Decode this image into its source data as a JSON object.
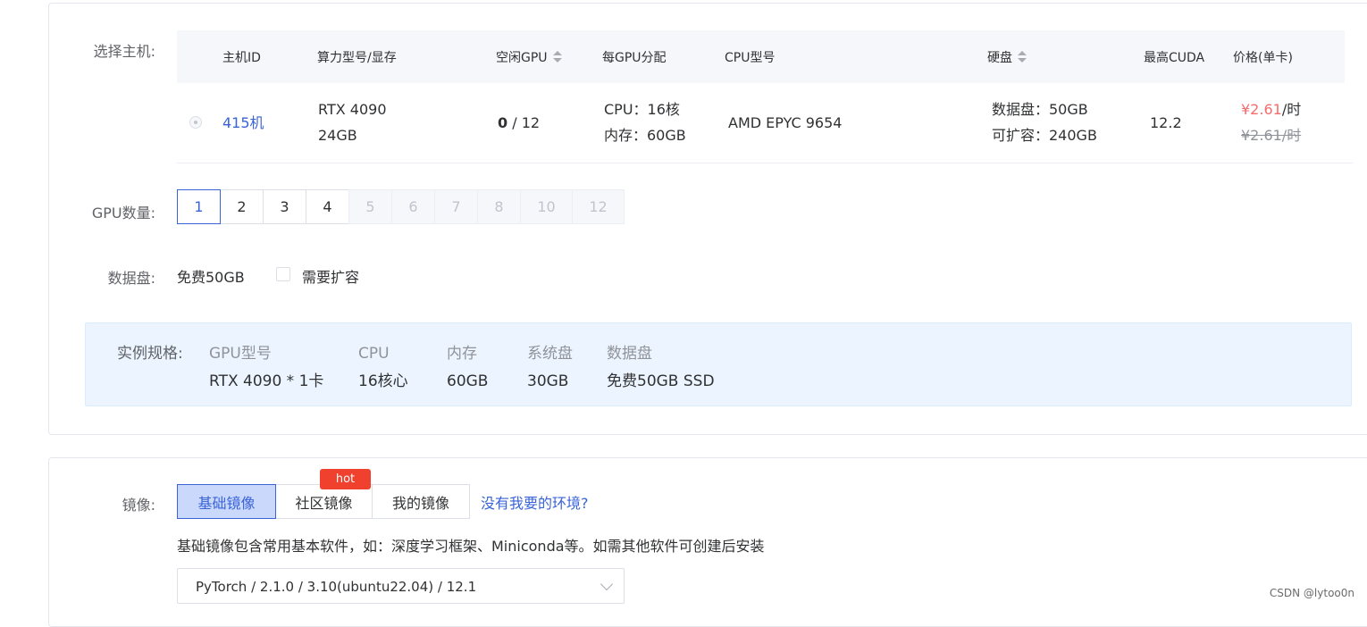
{
  "host_section": {
    "label": "选择主机:",
    "columns": {
      "host_id": "主机ID",
      "gpu_model": "算力型号/显存",
      "idle_gpu": "空闲GPU",
      "per_gpu": "每GPU分配",
      "cpu_model": "CPU型号",
      "disk": "硬盘",
      "max_cuda": "最高CUDA",
      "price": "价格(单卡)"
    },
    "row": {
      "host_name": "415机",
      "gpu_model": "RTX 4090",
      "vram": "24GB",
      "idle": "0",
      "idle_total": " / 12",
      "cpu": "CPU：16核",
      "mem": "内存：60GB",
      "cpu_model": "AMD EPYC 9654",
      "data_disk": "数据盘：50GB",
      "expandable": "可扩容：240GB",
      "cuda": "12.2",
      "price": "¥2.61",
      "price_unit": "/时",
      "original_price": "¥2.61/时"
    }
  },
  "gpu_count": {
    "label": "GPU数量:",
    "options": [
      "1",
      "2",
      "3",
      "4",
      "5",
      "6",
      "7",
      "8",
      "10",
      "12"
    ],
    "selected": "1"
  },
  "data_disk": {
    "label": "数据盘:",
    "free": "免费50GB",
    "expand_label": "需要扩容"
  },
  "spec": {
    "label": "实例规格:",
    "gpu_header": "GPU型号",
    "gpu_value": "RTX 4090 * 1卡",
    "cpu_header": "CPU",
    "cpu_value": "16核心",
    "mem_header": "内存",
    "mem_value": "60GB",
    "sys_header": "系统盘",
    "sys_value": "30GB",
    "data_header": "数据盘",
    "data_value": "免费50GB SSD"
  },
  "image_section": {
    "label": "镜像:",
    "tabs": [
      "基础镜像",
      "社区镜像",
      "我的镜像"
    ],
    "hot_badge": "hot",
    "missing_link": "没有我要的环境?",
    "description": "基础镜像包含常用基本软件，如：深度学习框架、Miniconda等。如需其他软件可创建后安装",
    "selected_image": "PyTorch / 2.1.0 / 3.10(ubuntu22.04) / 12.1"
  },
  "watermark": "CSDN @lytoo0n"
}
